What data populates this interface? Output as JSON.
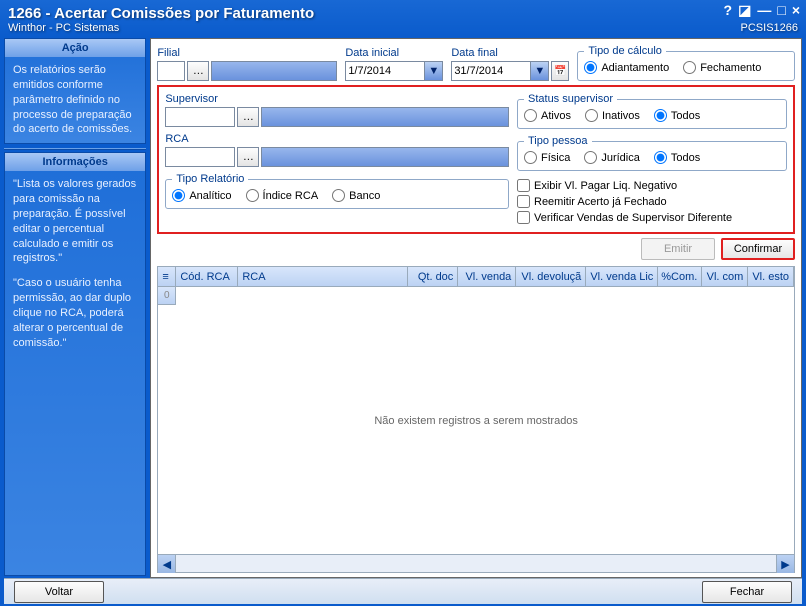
{
  "window": {
    "title": "1266 - Acertar Comissões por Faturamento",
    "subtitle": "Winthor - PC Sistemas",
    "code": "PCSIS1266"
  },
  "sidebar": {
    "acao": {
      "title": "Ação",
      "text": "Os relatórios serão emitidos conforme parâmetro definido no processo de preparação do acerto de comissões."
    },
    "info": {
      "title": "Informações",
      "p1": "\"Lista os valores gerados para comissão na preparação. É possível editar o percentual calculado e emitir os registros.\"",
      "p2": "\"Caso o usuário tenha permissão, ao dar duplo clique no RCA, poderá alterar o percentual de comissão.\""
    }
  },
  "form": {
    "filial_label": "Filial",
    "data_inicial_label": "Data inicial",
    "data_inicial_value": "1/7/2014",
    "data_final_label": "Data final",
    "data_final_value": "31/7/2014",
    "tipo_calculo": {
      "legend": "Tipo de cálculo",
      "adiantamento": "Adiantamento",
      "fechamento": "Fechamento",
      "selected": "adiantamento"
    },
    "supervisor_label": "Supervisor",
    "rca_label": "RCA",
    "status_supervisor": {
      "legend": "Status supervisor",
      "ativos": "Ativos",
      "inativos": "Inativos",
      "todos": "Todos",
      "selected": "todos"
    },
    "tipo_pessoa": {
      "legend": "Tipo pessoa",
      "fisica": "Física",
      "juridica": "Jurídica",
      "todos": "Todos",
      "selected": "todos"
    },
    "tipo_relatorio": {
      "legend": "Tipo Relatório",
      "analitico": "Analítico",
      "indice": "Índice RCA",
      "banco": "Banco",
      "selected": "analitico"
    },
    "chk_negativo": "Exibir Vl. Pagar Liq. Negativo",
    "chk_reemitir": "Reemitir Acerto já Fechado",
    "chk_verificar": "Verificar Vendas de Supervisor Diferente"
  },
  "buttons": {
    "emitir": "Emitir",
    "confirmar": "Confirmar",
    "voltar": "Voltar",
    "fechar": "Fechar"
  },
  "grid": {
    "cols": [
      "Cód. RCA",
      "RCA",
      "Qt. doc",
      "Vl. venda",
      "Vl. devoluçã",
      "Vl. venda Lic",
      "%Com.",
      "Vl. com",
      "Vl. esto"
    ],
    "empty": "Não existem registros a serem mostrados"
  }
}
